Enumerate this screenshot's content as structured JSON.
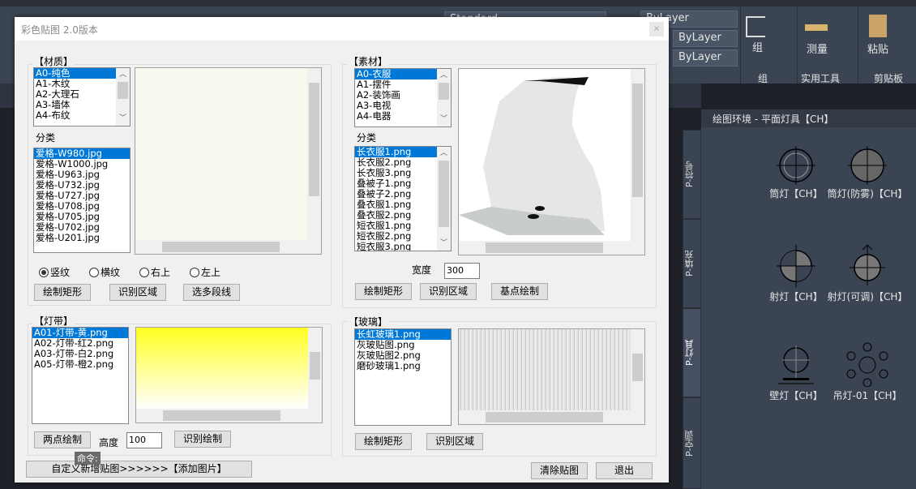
{
  "dialog": {
    "title": "彩色贴图 2.0版本",
    "close": "×"
  },
  "ribbon": {
    "text_style": "Standard",
    "layer1": "ByLayer",
    "layer2": "ByLayer",
    "layer3": "ByLayer",
    "group_btn": "组",
    "measure_btn": "测量",
    "paste_btn": "粘贴",
    "group_panel": "组",
    "utilities_panel": "实用工具",
    "clipboard_panel": "剪贴板"
  },
  "material": {
    "label": "【材质】",
    "types": [
      "A0-纯色",
      "A1-木纹",
      "A2-大理石",
      "A3-墙体",
      "A4-布纹"
    ],
    "category_label": "分类",
    "files": [
      "爱格-W980.jpg",
      "爱格-W1000.jpg",
      "爱格-U963.jpg",
      "爱格-U732.jpg",
      "爱格-U727.jpg",
      "爱格-U708.jpg",
      "爱格-U705.jpg",
      "爱格-U702.jpg",
      "爱格-U201.jpg"
    ],
    "radios": [
      "竖纹",
      "横纹",
      "右上",
      "左上"
    ],
    "selected_radio": "竖纹",
    "buttons": [
      "绘制矩形",
      "识别区域",
      "选多段线"
    ]
  },
  "asset": {
    "label": "【素材】",
    "types": [
      "A0-衣服",
      "A1-摆件",
      "A2-装饰画",
      "A3-电视",
      "A4-电器"
    ],
    "category_label": "分类",
    "files": [
      "长衣服1.png",
      "长衣服2.png",
      "长衣服3.png",
      "叠被子1.png",
      "叠被子2.png",
      "叠衣服1.png",
      "叠衣服2.png",
      "短衣服1.png",
      "短衣服2.png",
      "短衣服3.png"
    ],
    "width_label": "宽度",
    "width_value": "300",
    "buttons": [
      "绘制矩形",
      "识别区域",
      "基点绘制"
    ]
  },
  "lightstrip": {
    "label": "【灯带】",
    "files": [
      "A01-灯带-黄.png",
      "A02-灯带-红2.png",
      "A03-灯带-白2.png",
      "A05-灯带-橙2.png"
    ],
    "height_label": "高度",
    "height_value": "100",
    "buttons": [
      "两点绘制",
      "识别绘制"
    ]
  },
  "glass": {
    "label": "【玻璃】",
    "files": [
      "长虹玻璃1.png",
      "灰玻贴图.png",
      "灰玻贴图2.png",
      "磨砂玻璃1.png"
    ],
    "buttons": [
      "绘制矩形",
      "识别区域"
    ]
  },
  "footer": {
    "add_button": "自定义新增贴图>>>>>>【添加图片】",
    "clear_button": "清除贴图",
    "exit_button": "退出",
    "command_tip": "命令:"
  },
  "palette": {
    "title": "绘图环境 - 平面灯具【CH】",
    "tabs": [
      "P-符号",
      "P-填充",
      "P-灯具",
      "P-空调"
    ],
    "active_tab": "P-灯具",
    "tools": [
      "筒灯【CH】",
      "筒灯(防雾)【CH】",
      "射灯【CH】",
      "射灯(可调)【CH】",
      "壁灯【CH】",
      "吊灯-01【CH】"
    ]
  }
}
